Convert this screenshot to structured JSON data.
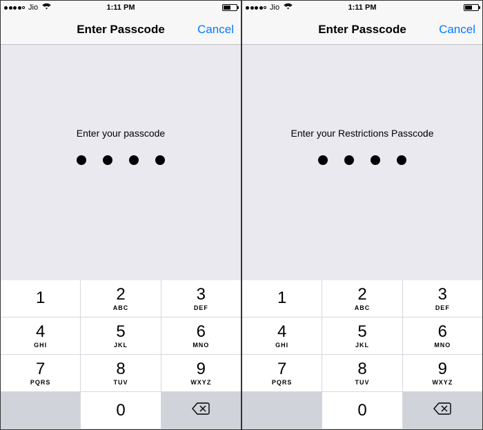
{
  "phones": [
    {
      "status": {
        "carrier": "Jio",
        "time": "1:11 PM"
      },
      "nav": {
        "title": "Enter Passcode",
        "cancel": "Cancel"
      },
      "prompt": "Enter your passcode"
    },
    {
      "status": {
        "carrier": "Jio",
        "time": "1:11 PM"
      },
      "nav": {
        "title": "Enter Passcode",
        "cancel": "Cancel"
      },
      "prompt": "Enter your Restrictions Passcode"
    }
  ],
  "keypad": {
    "rows": [
      [
        {
          "digit": "1",
          "letters": ""
        },
        {
          "digit": "2",
          "letters": "ABC"
        },
        {
          "digit": "3",
          "letters": "DEF"
        }
      ],
      [
        {
          "digit": "4",
          "letters": "GHI"
        },
        {
          "digit": "5",
          "letters": "JKL"
        },
        {
          "digit": "6",
          "letters": "MNO"
        }
      ],
      [
        {
          "digit": "7",
          "letters": "PQRS"
        },
        {
          "digit": "8",
          "letters": "TUV"
        },
        {
          "digit": "9",
          "letters": "WXYZ"
        }
      ]
    ],
    "zero": {
      "digit": "0",
      "letters": ""
    }
  }
}
